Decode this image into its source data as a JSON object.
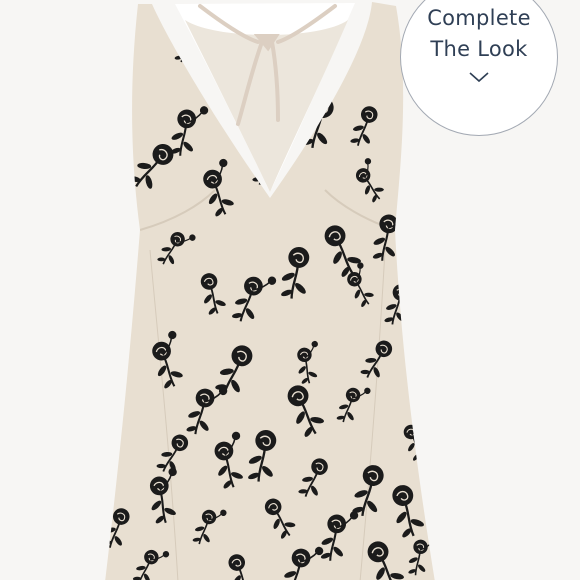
{
  "product_image": {
    "subject": "linen-blend V-neck mini dress with black floral embroidery",
    "icon": "dress-icon",
    "colors": {
      "background": "#f7f6f4",
      "fabric": "#e8dfd1",
      "fabric_shadow": "#d8cdbd",
      "embroidery": "#1b1b1b",
      "tie": "#dccfc2"
    }
  },
  "complete_the_look": {
    "line1": "Complete",
    "line2": "The Look",
    "icon": "chevron-down-icon",
    "colors": {
      "text": "#2f3f55",
      "border": "#a3a9b3",
      "fill": "#ffffff"
    }
  }
}
